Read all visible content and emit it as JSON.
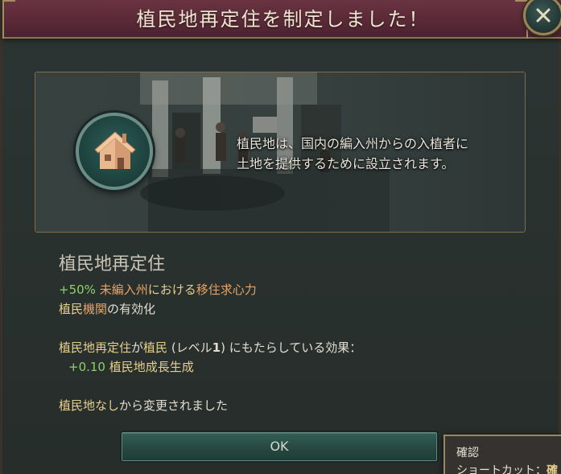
{
  "dialog": {
    "title": "植民地再定住を制定しました！",
    "banner_text_line1": "植民地は、国内の編入州からの入植者に",
    "banner_text_line2": "土地を提供するために設立されます。",
    "banner_icon": "house-icon",
    "close_icon": "close-icon"
  },
  "reform": {
    "name": "植民地再定住",
    "effect1_value": "+50%",
    "effect1_target": "未編入州",
    "effect1_mid": "における",
    "effect1_stat": "移住求心力",
    "effect2_prefix": "植民",
    "effect2_link": "機関",
    "effect2_suffix": "の有効化",
    "impact_subject": "植民地再定住",
    "impact_mid1": "が",
    "impact_target": "植民",
    "impact_paren_open": " (レベル",
    "impact_level": "1",
    "impact_paren_close": ") にもたらしている効果：",
    "impact_value": "+0.10",
    "impact_stat": "植民地成長生成",
    "changed_from": "植民地なし",
    "changed_suffix": "から変更されました"
  },
  "buttons": {
    "ok_label": "OK"
  },
  "tooltip": {
    "title": "確認",
    "shortcut_label": "ショートカット：",
    "shortcut_key": "確"
  },
  "colors": {
    "header": "#5a2a37",
    "positive": "#8fd16a",
    "highlight": "#e8a265",
    "link": "#e6cf8a",
    "button": "#274a43"
  }
}
